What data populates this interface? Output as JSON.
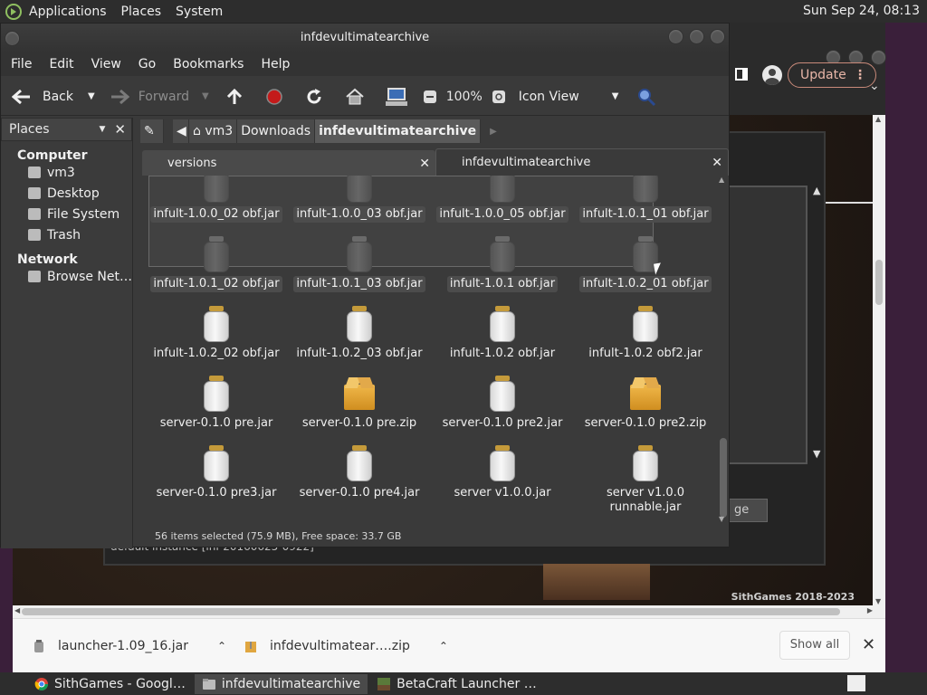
{
  "top_panel": {
    "menus": [
      "Applications",
      "Places",
      "System"
    ],
    "clock": "Sun Sep 24, 08:13"
  },
  "browser": {
    "update_label": "Update",
    "page": {
      "copyright": "SithGames 2018-2023",
      "instance_label": "default instance [inf-20160625-0922]",
      "button_partial": "ge"
    }
  },
  "caja": {
    "title": "infdevultimatearchive",
    "menus": [
      "File",
      "Edit",
      "View",
      "Go",
      "Bookmarks",
      "Help"
    ],
    "toolbar": {
      "back": "Back",
      "forward": "Forward",
      "zoom": "100%",
      "view_mode": "Icon View"
    },
    "sidebar": {
      "header": "Places",
      "sections": [
        {
          "title": "Computer",
          "items": [
            "vm3",
            "Desktop",
            "File System",
            "Trash"
          ]
        },
        {
          "title": "Network",
          "items": [
            "Browse Net…"
          ]
        }
      ]
    },
    "path": [
      "vm3",
      "Downloads",
      "infdevultimatearchive"
    ],
    "tabs": [
      "versions",
      "infdevultimatearchive"
    ],
    "files": [
      {
        "name": "infult-1.0.0_02 obf.jar",
        "type": "jar",
        "state": "faded-selected"
      },
      {
        "name": "infult-1.0.0_03 obf.jar",
        "type": "jar",
        "state": "faded-selected"
      },
      {
        "name": "infult-1.0.0_05 obf.jar",
        "type": "jar",
        "state": "faded-selected"
      },
      {
        "name": "infult-1.0.1_01 obf.jar",
        "type": "jar",
        "state": "faded-selected"
      },
      {
        "name": "infult-1.0.1_02 obf.jar",
        "type": "jar",
        "state": "faded-selected"
      },
      {
        "name": "infult-1.0.1_03 obf.jar",
        "type": "jar",
        "state": "faded-selected"
      },
      {
        "name": "infult-1.0.1 obf.jar",
        "type": "jar",
        "state": "faded-selected"
      },
      {
        "name": "infult-1.0.2_01 obf.jar",
        "type": "jar",
        "state": "faded-selected"
      },
      {
        "name": "infult-1.0.2_02 obf.jar",
        "type": "jar",
        "state": "normal"
      },
      {
        "name": "infult-1.0.2_03 obf.jar",
        "type": "jar",
        "state": "normal"
      },
      {
        "name": "infult-1.0.2 obf.jar",
        "type": "jar",
        "state": "normal"
      },
      {
        "name": "infult-1.0.2 obf2.jar",
        "type": "jar",
        "state": "normal"
      },
      {
        "name": "server-0.1.0 pre.jar",
        "type": "jar",
        "state": "normal"
      },
      {
        "name": "server-0.1.0 pre.zip",
        "type": "zip",
        "state": "normal"
      },
      {
        "name": "server-0.1.0 pre2.jar",
        "type": "jar",
        "state": "normal"
      },
      {
        "name": "server-0.1.0 pre2.zip",
        "type": "zip",
        "state": "normal"
      },
      {
        "name": "server-0.1.0 pre3.jar",
        "type": "jar",
        "state": "normal"
      },
      {
        "name": "server-0.1.0 pre4.jar",
        "type": "jar",
        "state": "normal"
      },
      {
        "name": "server v1.0.0.jar",
        "type": "jar",
        "state": "normal"
      },
      {
        "name": "server v1.0.0 runnable.jar",
        "type": "jar",
        "state": "normal"
      }
    ],
    "status": "56 items selected (75.9 MB), Free space: 33.7 GB"
  },
  "downloads": {
    "items": [
      "launcher-1.09_16.jar",
      "infdevultimatear….zip"
    ],
    "show_all": "Show all"
  },
  "taskbar": {
    "tasks": [
      "SithGames - Googl…",
      "infdevultimatearchive",
      "BetaCraft Launcher …"
    ]
  }
}
